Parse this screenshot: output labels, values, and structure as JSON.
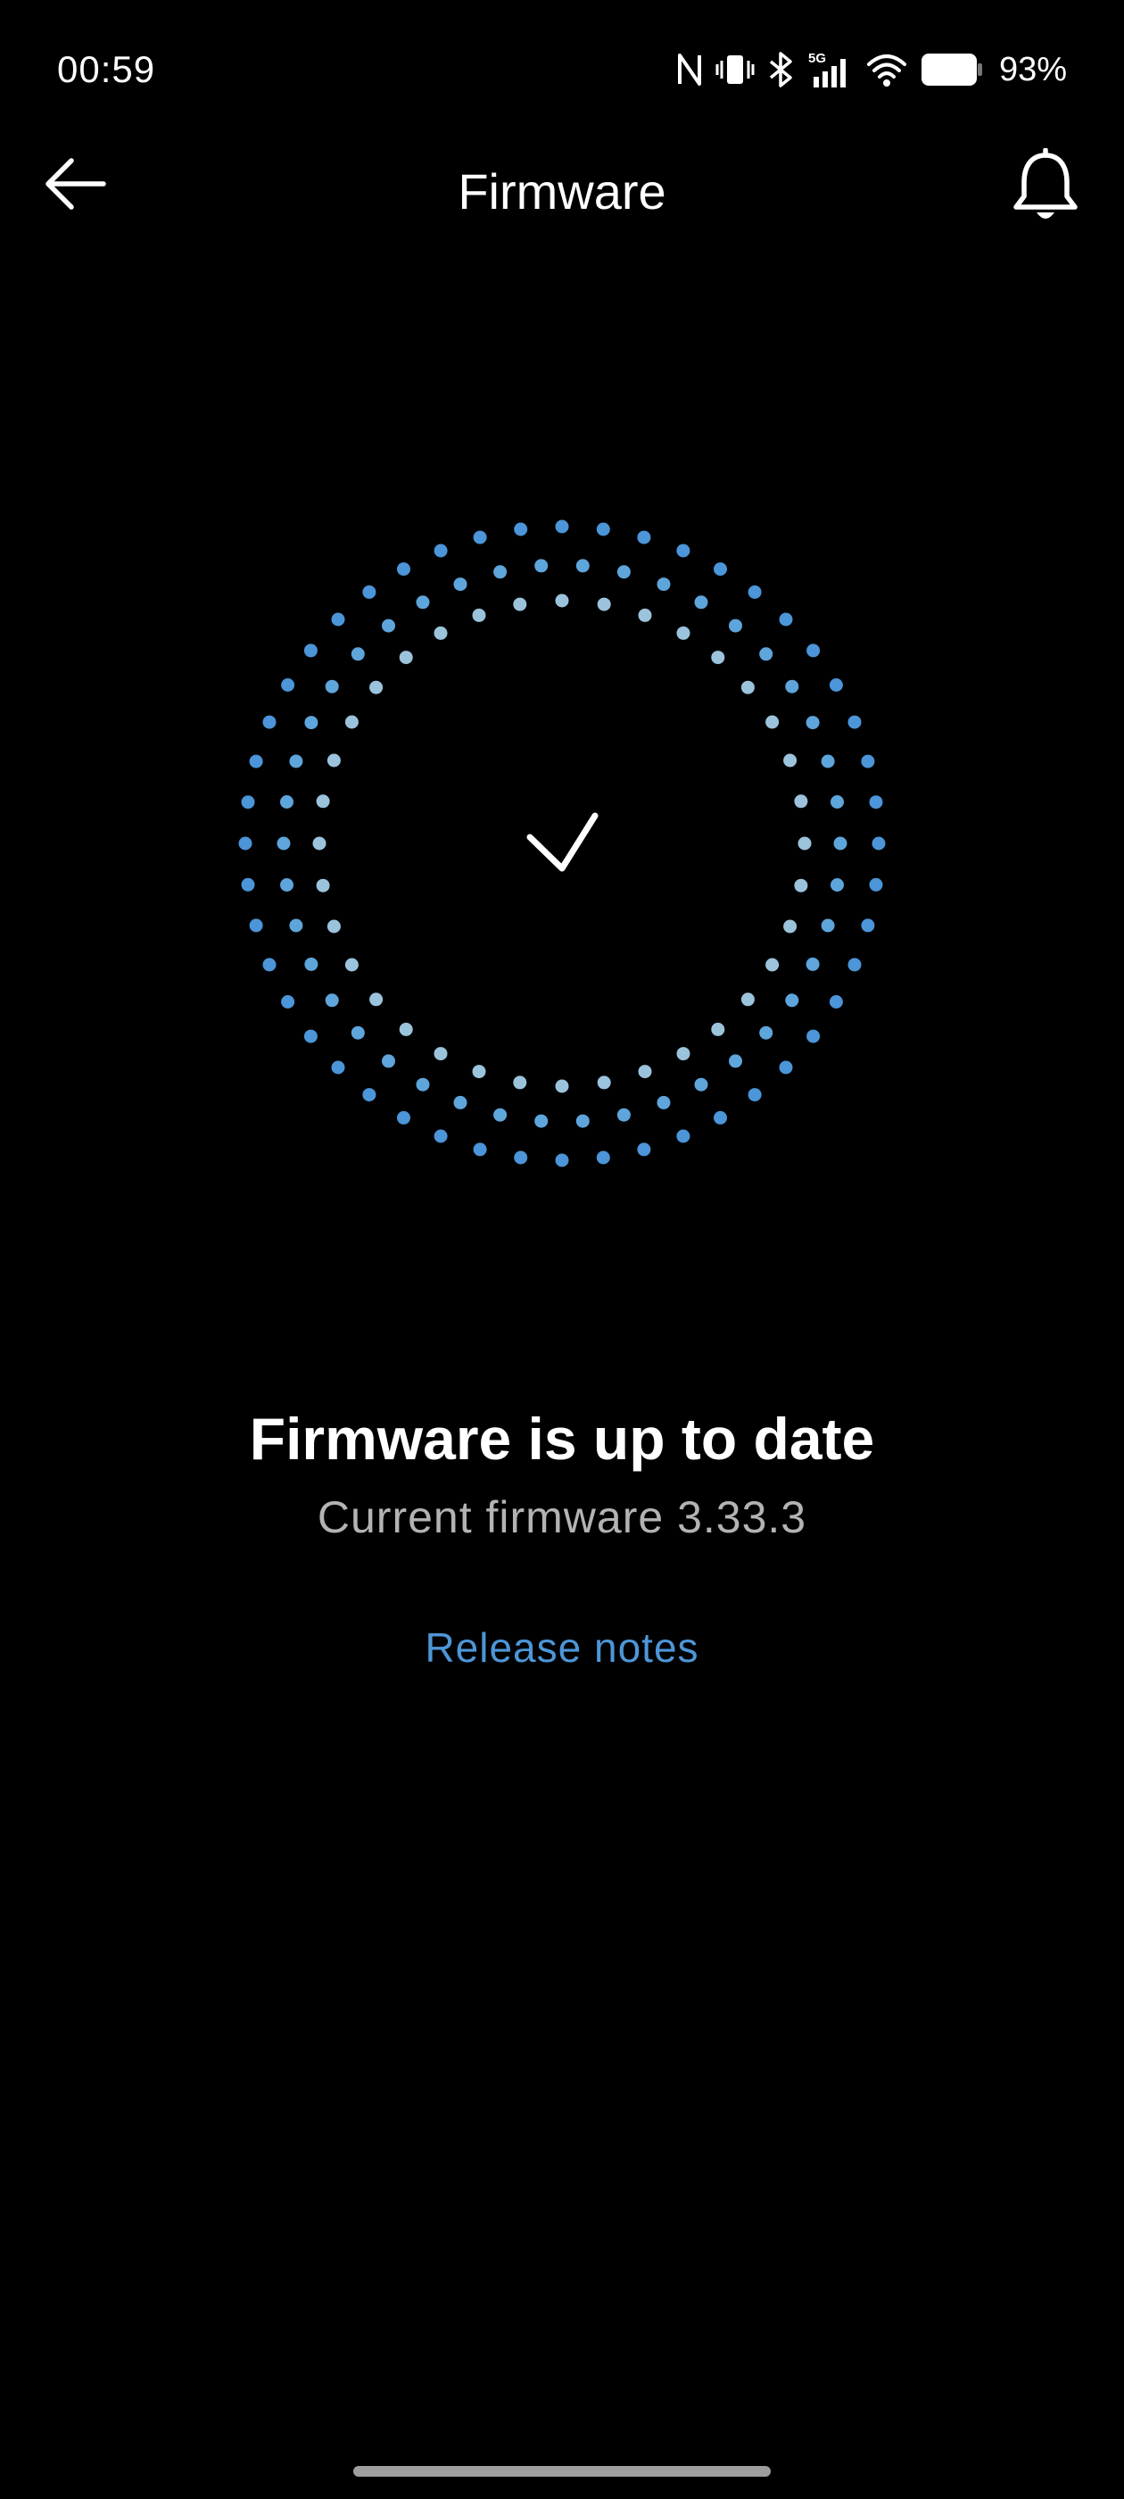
{
  "status_bar": {
    "time": "00:59",
    "network": "5G",
    "battery_percent": "93%",
    "battery_level": 0.93,
    "icons": [
      "nfc-icon",
      "vibrate-icon",
      "bluetooth-icon",
      "signal-5g-icon",
      "wifi-icon",
      "battery-icon"
    ]
  },
  "app_bar": {
    "title": "Firmware",
    "back_icon": "arrow-left-icon",
    "notification_icon": "bell-icon"
  },
  "status": {
    "icon": "checkmark-icon",
    "heading": "Firmware is up to date",
    "current_firmware": "Current firmware 3.33.3",
    "release_notes_link": "Release notes"
  },
  "colors": {
    "background": "#000000",
    "dot_outer": "#4b95d8",
    "dot_middle": "#5ea5dc",
    "dot_inner": "#9cc3dc",
    "link": "#4d96d8",
    "secondary_text": "#b3b3b3"
  }
}
